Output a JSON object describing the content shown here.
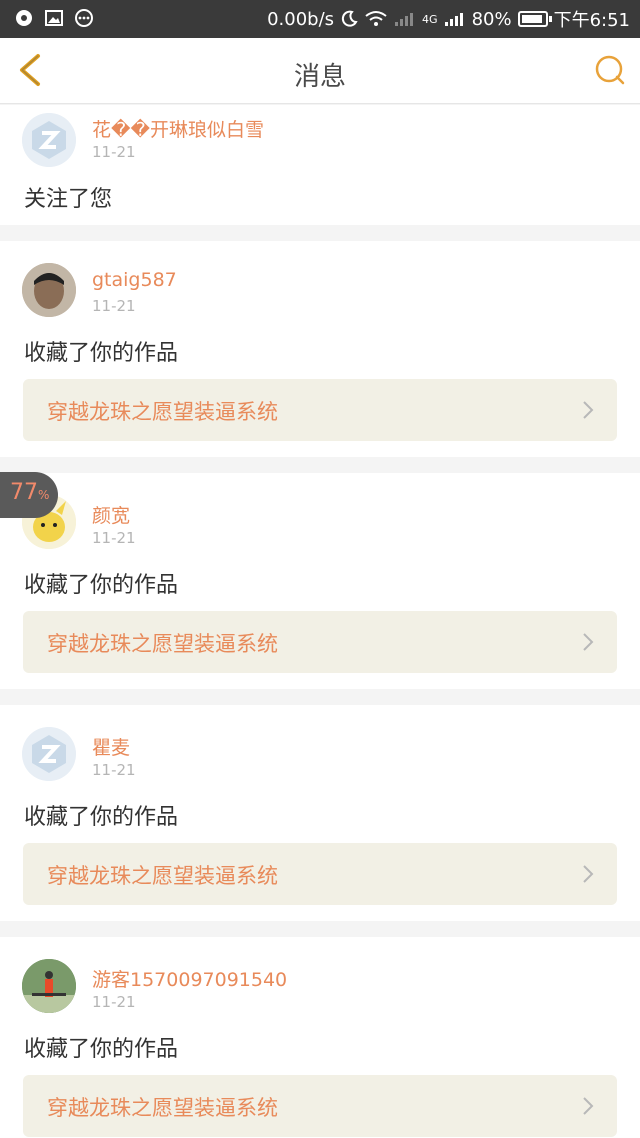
{
  "status_bar": {
    "speed": "0.00b/s",
    "battery": "80%",
    "time": "下午6:51",
    "network": "4G"
  },
  "header": {
    "title": "消息",
    "back_icon": "chevron-left-icon",
    "search_icon": "search-icon"
  },
  "float_badge": {
    "value": "77",
    "unit": "%"
  },
  "messages": [
    {
      "user": "花��开琳琅似白雪",
      "date": "11-21",
      "action": "关注了您",
      "work": ""
    },
    {
      "user": "gtaig587",
      "date": "11-21",
      "action": "收藏了你的作品",
      "work": "穿越龙珠之愿望装逼系统"
    },
    {
      "user": "颜宽",
      "date": "11-21",
      "action": "收藏了你的作品",
      "work": "穿越龙珠之愿望装逼系统"
    },
    {
      "user": "瞿麦",
      "date": "11-21",
      "action": "收藏了你的作品",
      "work": "穿越龙珠之愿望装逼系统"
    },
    {
      "user": "游客1570097091540",
      "date": "11-21",
      "action": "收藏了你的作品",
      "work": "穿越龙珠之愿望装逼系统"
    }
  ],
  "colors": {
    "accent": "#e88a5a",
    "work_bg": "#f2f0e5",
    "status_bar": "#3a3a3a"
  }
}
